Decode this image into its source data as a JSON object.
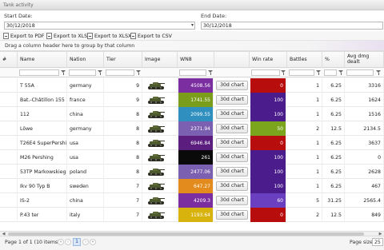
{
  "window": {
    "title": "Tank activity"
  },
  "dates": {
    "start_label": "Start Date:",
    "start_value": "30/12/2018",
    "end_label": "End Date:",
    "end_value": "30/12/2018"
  },
  "toolbar": {
    "pdf": "Export to PDF",
    "xls": "Export to XLS",
    "xlsx": "Export to XLSX",
    "csv": "Export to CSV"
  },
  "group_panel": "Drag a column header here to group by that column",
  "columns": {
    "hash": "#",
    "name": "Name",
    "nation": "Nation",
    "tier": "Tier",
    "image": "Image",
    "wn8": "WN8",
    "chart": "",
    "winrate": "Win rate",
    "battles": "Battles",
    "pct": "%",
    "avgdmg": "Avg dmg dealt"
  },
  "rows": [
    {
      "name": "T 55A",
      "nation": "germany",
      "tier": "9",
      "wn8": "4508.56",
      "wn8_color": "#7b2ea0",
      "chart": "30d chart",
      "winrate": "0",
      "wr_color": "#b80d0d",
      "battles": "1",
      "pct": "6.25",
      "avgdmg": "3316"
    },
    {
      "name": "Bat.-Châtillon 155 55",
      "nation": "france",
      "tier": "9",
      "wn8": "1741.55",
      "wn8_color": "#7a9e1b",
      "chart": "30d chart",
      "winrate": "100",
      "wr_color": "#4a1c8c",
      "battles": "1",
      "pct": "6.25",
      "avgdmg": "1624"
    },
    {
      "name": "112",
      "nation": "china",
      "tier": "8",
      "wn8": "2099.55",
      "wn8_color": "#2f8fbf",
      "chart": "30d chart",
      "winrate": "100",
      "wr_color": "#4a1c8c",
      "battles": "1",
      "pct": "6.25",
      "avgdmg": "1516"
    },
    {
      "name": "Löwe",
      "nation": "germany",
      "tier": "8",
      "wn8": "2371.94",
      "wn8_color": "#7b5fb0",
      "chart": "30d chart",
      "winrate": "50",
      "wr_color": "#7aa51d",
      "battles": "2",
      "pct": "12.5",
      "avgdmg": "2134.5"
    },
    {
      "name": "T26E4 SuperPershing",
      "nation": "usa",
      "tier": "8",
      "wn8": "6946.84",
      "wn8_color": "#5b1e7e",
      "chart": "30d chart",
      "winrate": "0",
      "wr_color": "#b80d0d",
      "battles": "1",
      "pct": "6.25",
      "avgdmg": "3637"
    },
    {
      "name": "M26 Pershing",
      "nation": "usa",
      "tier": "8",
      "wn8": "261",
      "wn8_color": "#0a0a0a",
      "chart": "30d chart",
      "winrate": "100",
      "wr_color": "#4a1c8c",
      "battles": "1",
      "pct": "6.25",
      "avgdmg": "0"
    },
    {
      "name": "53TP Markowskiego",
      "nation": "poland",
      "tier": "8",
      "wn8": "2477.06",
      "wn8_color": "#7b5fb0",
      "chart": "30d chart",
      "winrate": "100",
      "wr_color": "#4a1c8c",
      "battles": "1",
      "pct": "6.25",
      "avgdmg": "2628"
    },
    {
      "name": "Ikv 90 Typ B",
      "nation": "sweden",
      "tier": "7",
      "wn8": "647.27",
      "wn8_color": "#e38b1c",
      "chart": "30d chart",
      "winrate": "100",
      "wr_color": "#4a1c8c",
      "battles": "1",
      "pct": "6.25",
      "avgdmg": "467"
    },
    {
      "name": "IS-2",
      "nation": "china",
      "tier": "7",
      "wn8": "4209.3",
      "wn8_color": "#7b2ea0",
      "chart": "30d chart",
      "winrate": "60",
      "wr_color": "#6a3fc0",
      "battles": "5",
      "pct": "31.25",
      "avgdmg": "2565.4"
    },
    {
      "name": "P.43 ter",
      "nation": "italy",
      "tier": "7",
      "wn8": "1193.64",
      "wn8_color": "#d8b20d",
      "chart": "30d chart",
      "winrate": "0",
      "wr_color": "#b80d0d",
      "battles": "2",
      "pct": "12.5",
      "avgdmg": "849"
    }
  ],
  "pager": {
    "info": "Page 1 of 1 (10 items)",
    "current": "1",
    "first": "«",
    "prev": "‹",
    "next": "›",
    "last": "»",
    "size_label": "Page size:",
    "size_value": "25"
  }
}
